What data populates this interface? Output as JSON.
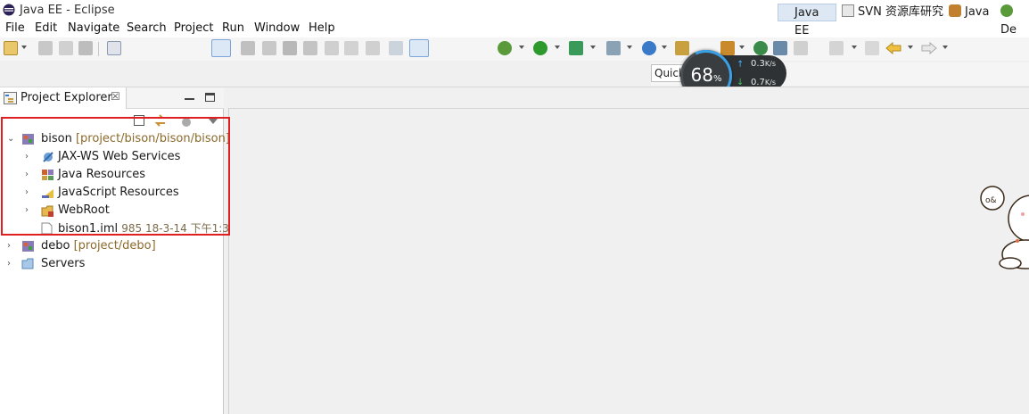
{
  "window": {
    "title": "Java EE - Eclipse"
  },
  "menu": [
    "File",
    "Edit",
    "Navigate",
    "Search",
    "Project",
    "Run",
    "Window",
    "Help"
  ],
  "quick_access": {
    "value": "Quick"
  },
  "net_monitor": {
    "percent": "68",
    "percent_unit": "%",
    "upload": "0.3",
    "download": "0.7",
    "unit": "K/s"
  },
  "perspectives": [
    {
      "label": "Java EE",
      "active": true
    },
    {
      "label": "SVN 资源库研究",
      "active": false
    },
    {
      "label": "Java",
      "active": false
    },
    {
      "label": "De",
      "active": false
    }
  ],
  "view": {
    "tab_label": "Project Explorer",
    "close_glyph": "☒"
  },
  "tree": {
    "bison": {
      "label": "bison",
      "decoration": "[project/bison/bison/bison]"
    },
    "bison_children": [
      {
        "label": "JAX-WS Web Services"
      },
      {
        "label": "Java Resources"
      },
      {
        "label": "JavaScript Resources"
      },
      {
        "label": "WebRoot"
      }
    ],
    "bison_file": {
      "label": "bison1.iml",
      "decoration": "985  18-3-14 下午1:3"
    },
    "debo": {
      "label": "debo",
      "decoration": "[project/debo]"
    },
    "servers": {
      "label": "Servers"
    }
  },
  "colors": {
    "highlight_box": "#e02020",
    "decoration": "#8b6a2a",
    "net_arc": "#3aa0e6"
  },
  "icons": [
    "eclipse-icon",
    "new-icon",
    "save-icon",
    "save-all-icon",
    "print-icon",
    "binary-icon",
    "skip-breakpoints-icon",
    "resume-icon",
    "suspend-icon",
    "terminate-icon",
    "disconnect-icon",
    "step-into-icon",
    "step-over-icon",
    "step-return-icon",
    "drop-to-frame-icon",
    "use-step-filters-icon",
    "debug-icon",
    "run-icon",
    "coverage-icon",
    "external-tools-icon",
    "new-server-icon",
    "open-type-icon",
    "search-icon",
    "back-icon",
    "forward-icon"
  ]
}
